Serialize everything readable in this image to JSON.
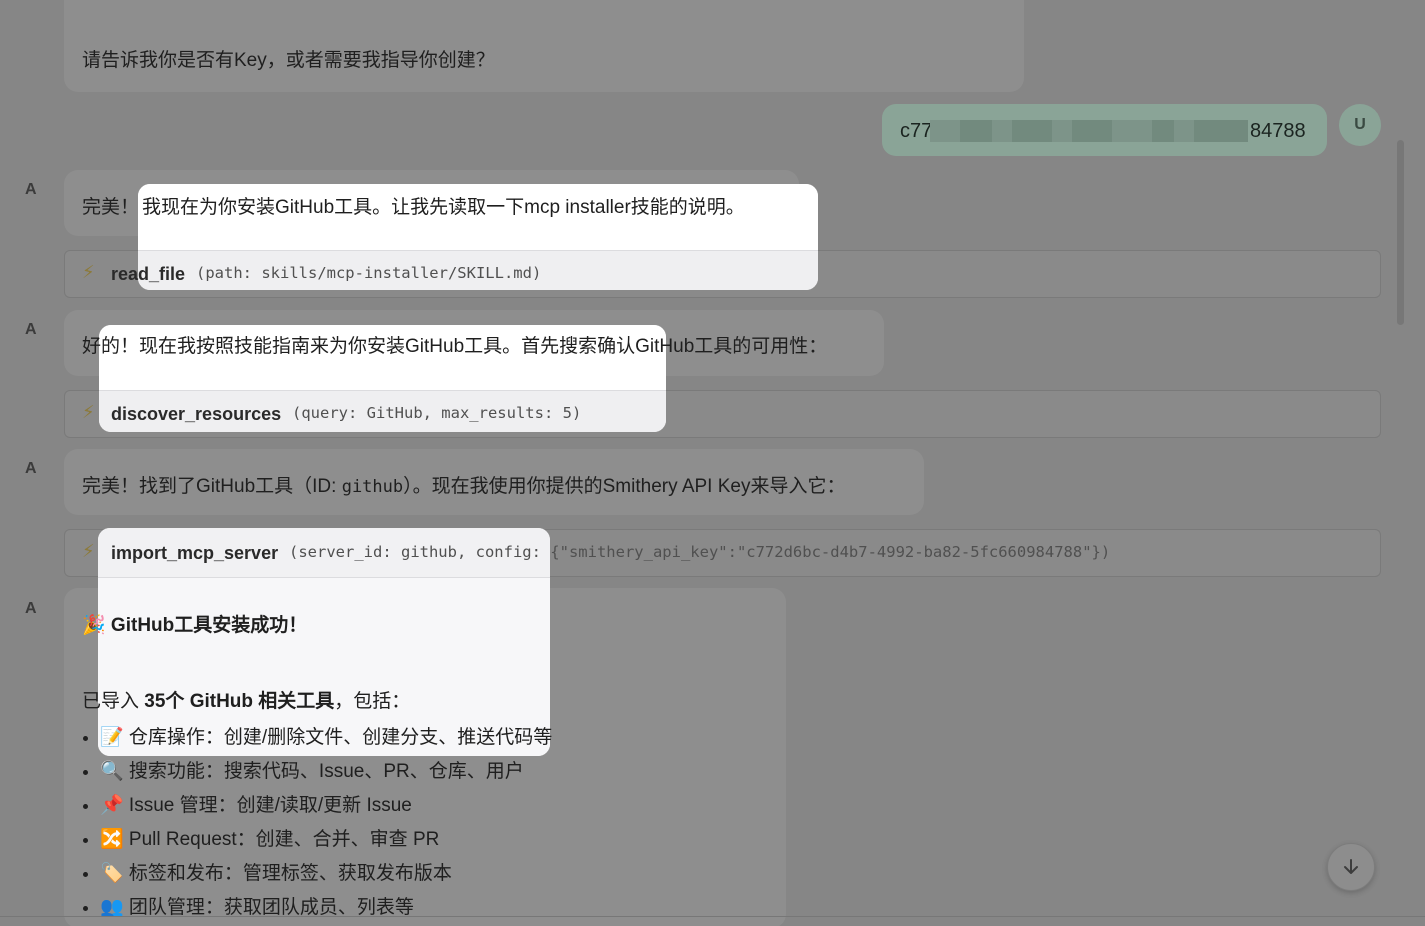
{
  "messages": {
    "prev_text": "请告诉我你是否有Key，或者需要我指导你创建？",
    "user_avatar": "U",
    "user_key_start": "c77",
    "user_key_end": "84788",
    "assistant_avatar": "A",
    "m1_prefix": "完美！",
    "m1_text": "我现在为你安装GitHub工具。让我先读取一下mcp installer技能的说明。",
    "m2_text": "好的！现在我按照技能指南来为你安装GitHub工具。首先搜索确认GitHub工具的可用性：",
    "m3_part1": "完美！找到了GitHub工具（ID: ",
    "m3_code": "github",
    "m3_part2": "）。现在我使用你提供的Smithery API Key来导入它：",
    "m4_title": "🎉 GitHub工具安装成功！",
    "m4_intro_a": "已导入 ",
    "m4_intro_bold": "35个 GitHub 相关工具",
    "m4_intro_b": "，包括："
  },
  "tools": {
    "t1_name": "read_file",
    "t1_args": "(path: skills/mcp-installer/SKILL.md)",
    "t2_name": "discover_resources",
    "t2_args": "(query: GitHub, max_results: 5)",
    "t3_name": "import_mcp_server",
    "t3_args_a": "(server_id: github, config",
    "t3_args_b": ": {\"smithery_api_key\":\"c772d6bc-d4b7-4992-ba82-5fc660984788\"})",
    "bolt_icon": "⚡"
  },
  "features": [
    "📝 仓库操作：创建/删除文件、创建分支、推送代码等",
    "🔍 搜索功能：搜索代码、Issue、PR、仓库、用户",
    "📌 Issue 管理：创建/读取/更新 Issue",
    "🔀 Pull Request：创建、合并、审查 PR",
    "🏷️ 标签和发布：管理标签、获取发布版本",
    "👥 团队管理：获取团队成员、列表等"
  ],
  "icons": {
    "scroll_down": "arrow-down-icon"
  }
}
